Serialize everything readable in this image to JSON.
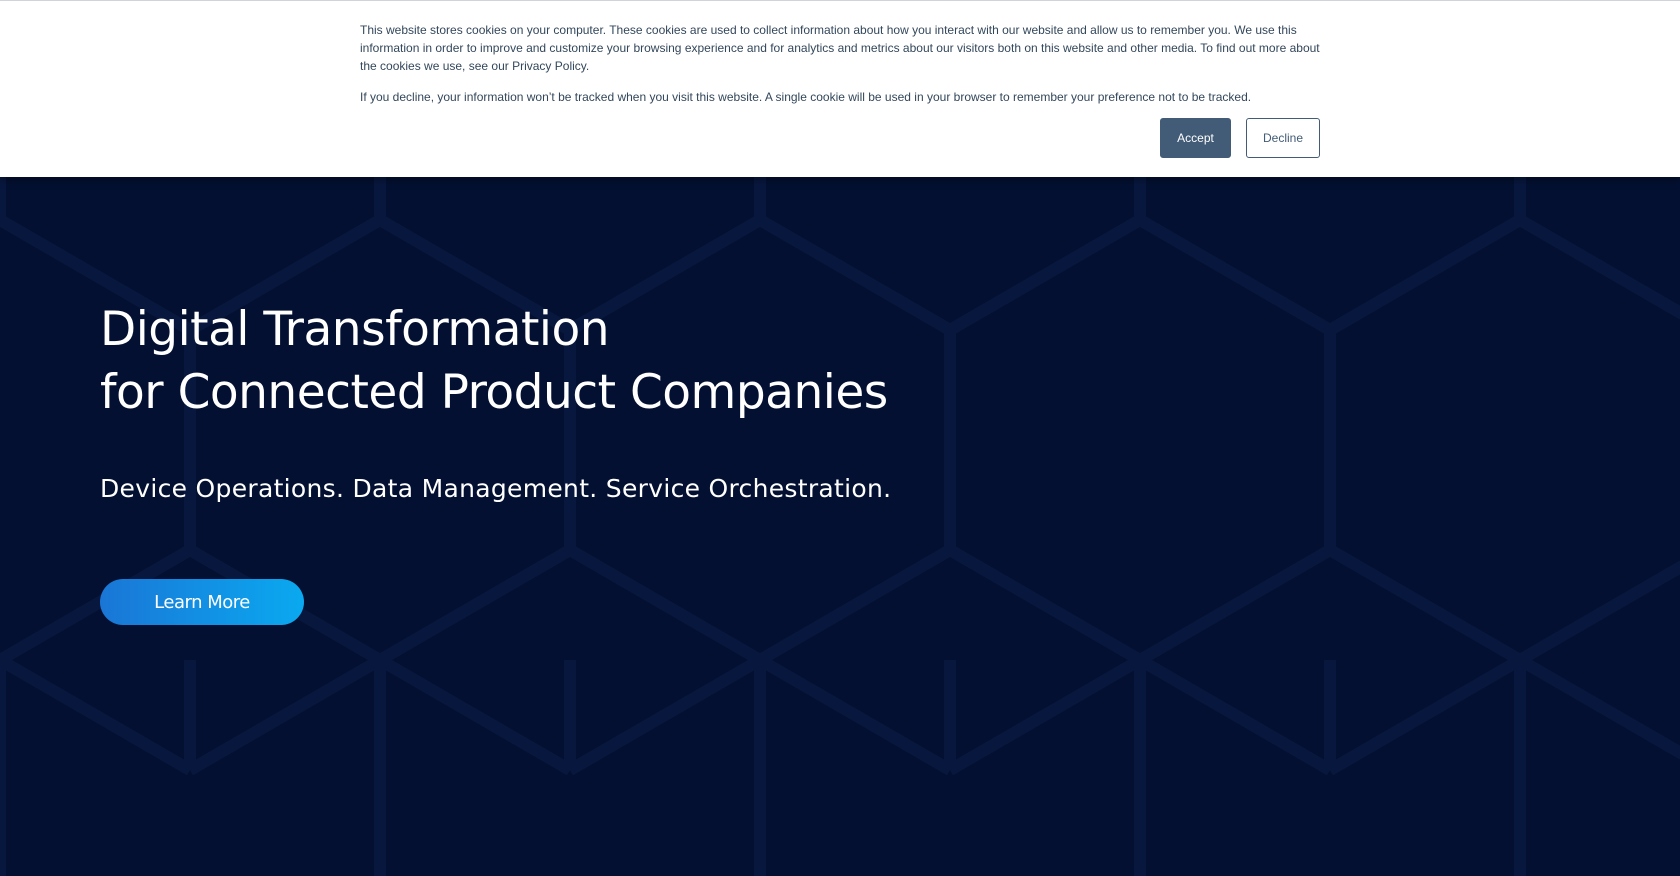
{
  "cookie_banner": {
    "paragraph_1": "This website stores cookies on your computer. These cookies are used to collect information about how you interact with our website and allow us to remember you. We use this information in order to improve and customize your browsing experience and for analytics and metrics about our visitors both on this website and other media. To find out more about the cookies we use, see our Privacy Policy.",
    "paragraph_2": "If you decline, your information won’t be tracked when you visit this website. A single cookie will be used in your browser to remember your preference not to be tracked.",
    "accept_label": "Accept",
    "decline_label": "Decline"
  },
  "hero": {
    "title_line_1": "Digital Transformation",
    "title_line_2": "for Connected Product Companies",
    "subtitle": "Device Operations. Data Management. Service Orchestration.",
    "cta_label": "Learn More"
  },
  "colors": {
    "background": "#031031",
    "hex_line": "#0e2150",
    "banner_background": "#ffffff",
    "banner_text": "#33475b",
    "accept_button": "#425b76",
    "cta_gradient_start": "#1a76d6",
    "cta_gradient_end": "#0aa9f0"
  }
}
